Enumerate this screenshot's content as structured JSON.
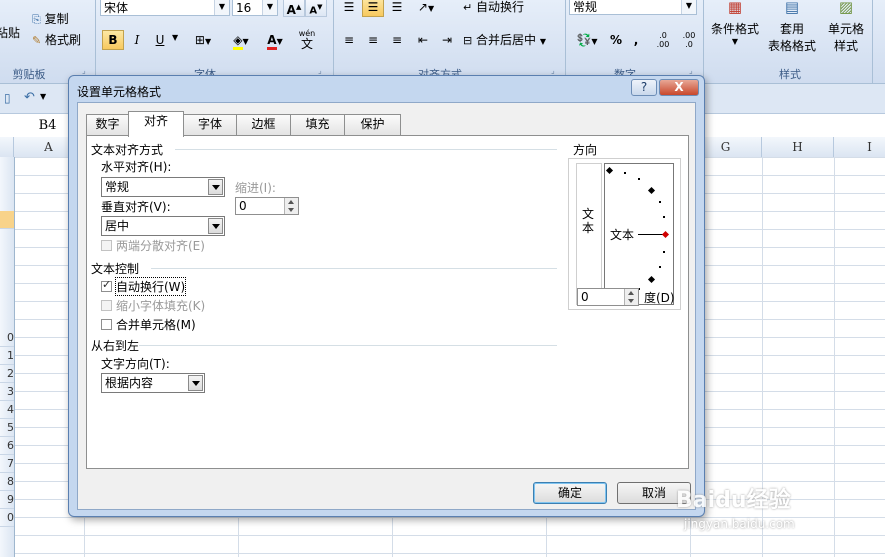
{
  "ribbon": {
    "clipboard": {
      "paste": "粘贴",
      "copy": "复制",
      "format_painter": "格式刷",
      "group_label": "剪贴板"
    },
    "font": {
      "name": "宋体",
      "size": "16",
      "group_label": "字体",
      "bold": "B",
      "italic": "I",
      "underline": "U",
      "font_color": "A",
      "phonetic": "wén",
      "phonetic_sub": "文"
    },
    "alignment": {
      "wrap_text": "自动换行",
      "merge_center": "合并后居中",
      "group_label": "对齐方式"
    },
    "number": {
      "format": "常规",
      "group_label": "数字",
      "percent": "%",
      "comma": ",",
      "dec_inc": ".0 .00",
      "dec_dec": ".00 .0"
    },
    "styles": {
      "conditional": "条件格式",
      "as_table_1": "套用",
      "as_table_2": "表格格式",
      "cell_styles_1": "单元格",
      "cell_styles_2": "样式",
      "group_label": "样式"
    }
  },
  "sheet": {
    "name_box": "B4",
    "columns": [
      "A",
      "G",
      "H",
      "I"
    ],
    "row_numbers": [
      "0",
      "1",
      "2",
      "3",
      "4",
      "5",
      "6",
      "7",
      "8",
      "9",
      "0"
    ]
  },
  "dialog": {
    "title": "设置单元格格式",
    "help": "?",
    "close": "X",
    "tabs": [
      "数字",
      "对齐",
      "字体",
      "边框",
      "填充",
      "保护"
    ],
    "text_alignment": {
      "section": "文本对齐方式",
      "horizontal_label": "水平对齐(H):",
      "horizontal_value": "常规",
      "indent_label": "缩进(I):",
      "indent_value": "0",
      "vertical_label": "垂直对齐(V):",
      "vertical_value": "居中",
      "justify_distributed": "两端分散对齐(E)"
    },
    "text_control": {
      "section": "文本控制",
      "wrap_text": "自动换行(W)",
      "wrap_text_checked": true,
      "shrink_to_fit": "缩小字体填充(K)",
      "merge_cells": "合并单元格(M)"
    },
    "rtl": {
      "section": "从右到左",
      "direction_label": "文字方向(T):",
      "direction_value": "根据内容"
    },
    "orientation": {
      "section": "方向",
      "vertical_text": "文本",
      "sample_text": "文本",
      "degrees_value": "0",
      "degrees_label": "度(D)"
    },
    "ok": "确定",
    "cancel": "取消"
  },
  "watermark": {
    "brand": "Baidu经验",
    "url": "jingyan.baidu.com"
  }
}
